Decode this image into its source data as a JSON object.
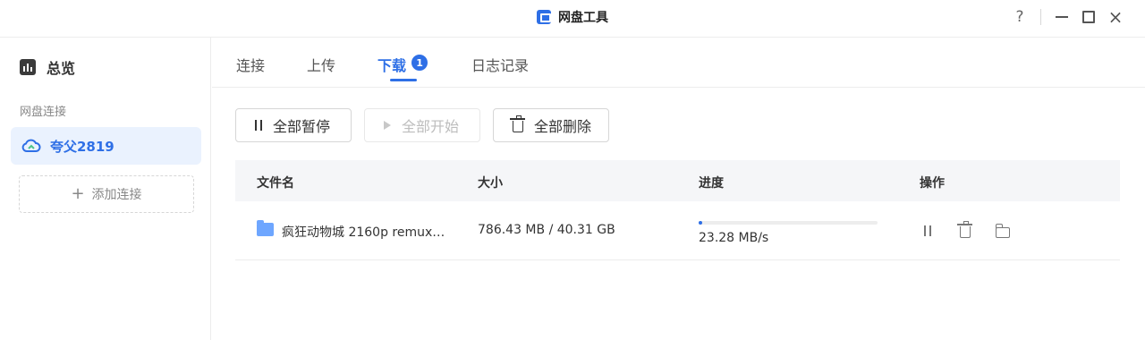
{
  "window": {
    "title": "网盘工具",
    "help_label": "?",
    "close_label": "×"
  },
  "sidebar": {
    "overview_label": "总览",
    "section_label": "网盘连接",
    "connection_label": "夸父2819",
    "add_connection_label": "添加连接",
    "add_icon_label": "+"
  },
  "tabs": [
    {
      "label": "连接"
    },
    {
      "label": "上传"
    },
    {
      "label": "下载",
      "badge": "1",
      "active": true
    },
    {
      "label": "日志记录"
    }
  ],
  "toolbar": {
    "pause_all_label": "全部暂停",
    "start_all_label": "全部开始",
    "delete_all_label": "全部删除"
  },
  "table": {
    "headers": [
      "文件名",
      "大小",
      "进度",
      "操作"
    ],
    "rows": [
      {
        "name": "疯狂动物城 2160p remux…",
        "size": "786.43 MB / 40.31 GB",
        "progress": 0.019,
        "speed": "23.28 MB/s"
      }
    ]
  },
  "colors": {
    "accent": "#2e6fe6",
    "active_bg": "#eaf2fe",
    "header_bg": "#f5f6f8"
  }
}
